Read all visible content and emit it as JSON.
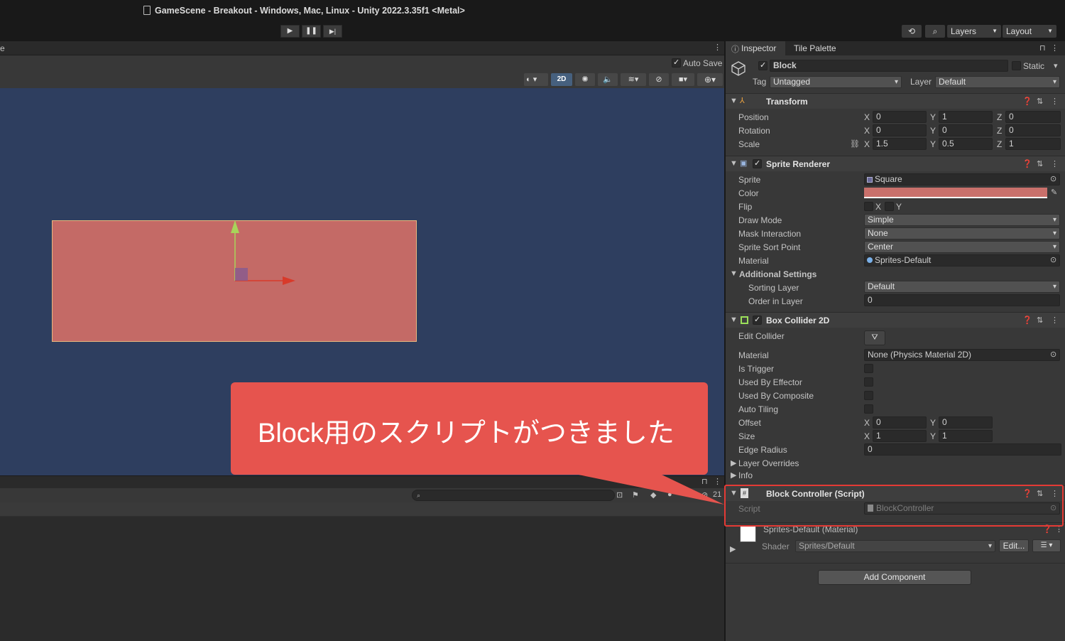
{
  "window": {
    "title": "GameScene - Breakout - Windows, Mac, Linux - Unity 2022.3.35f1 <Metal>"
  },
  "toolbar": {
    "play": "▶",
    "pause": "❚❚",
    "step": "▶|",
    "history_icon": "history-icon",
    "search_icon": "search-icon",
    "layers": "Layers",
    "layout": "Layout"
  },
  "scene": {
    "tab_label": "e",
    "auto_save": "Auto Save",
    "mode_2d": "2D",
    "search_count": "21"
  },
  "inspector": {
    "tabs": [
      "Inspector",
      "Tile Palette"
    ],
    "object": {
      "name": "Block",
      "static_label": "Static",
      "tag_label": "Tag",
      "tag": "Untagged",
      "layer_label": "Layer",
      "layer": "Default"
    },
    "transform": {
      "title": "Transform",
      "rows": [
        {
          "label": "Position",
          "x": "0",
          "y": "1",
          "z": "0"
        },
        {
          "label": "Rotation",
          "x": "0",
          "y": "0",
          "z": "0"
        },
        {
          "label": "Scale",
          "x": "1.5",
          "y": "0.5",
          "z": "1"
        }
      ]
    },
    "sprite_renderer": {
      "title": "Sprite Renderer",
      "sprite_label": "Sprite",
      "sprite": "Square",
      "color_label": "Color",
      "color_value": "#c9706b",
      "flip_label": "Flip",
      "flip_x": "X",
      "flip_y": "Y",
      "draw_mode_label": "Draw Mode",
      "draw_mode": "Simple",
      "mask_label": "Mask Interaction",
      "mask": "None",
      "sort_point_label": "Sprite Sort Point",
      "sort_point": "Center",
      "material_label": "Material",
      "material": "Sprites-Default",
      "additional_settings": "Additional Settings",
      "sorting_layer_label": "Sorting Layer",
      "sorting_layer": "Default",
      "order_label": "Order in Layer",
      "order": "0"
    },
    "box_collider": {
      "title": "Box Collider 2D",
      "edit_collider": "Edit Collider",
      "material_label": "Material",
      "material": "None (Physics Material 2D)",
      "is_trigger": "Is Trigger",
      "used_by_effector": "Used By Effector",
      "used_by_composite": "Used By Composite",
      "auto_tiling": "Auto Tiling",
      "offset_label": "Offset",
      "offset_x": "0",
      "offset_y": "0",
      "size_label": "Size",
      "size_x": "1",
      "size_y": "1",
      "edge_radius_label": "Edge Radius",
      "edge_radius": "0",
      "layer_overrides": "Layer Overrides",
      "info": "Info"
    },
    "block_controller": {
      "title": "Block Controller (Script)",
      "script_label": "Script",
      "script": "BlockController"
    },
    "material_section": {
      "title": "Sprites-Default (Material)",
      "shader_label": "Shader",
      "shader": "Sprites/Default",
      "edit": "Edit..."
    },
    "add_component": "Add Component"
  },
  "callout": {
    "text": "Block用のスクリプトがつきました"
  },
  "colors": {
    "accent_red": "#e6544e",
    "block_fill": "#c46a66",
    "scene_bg": "#2e3e5f"
  }
}
